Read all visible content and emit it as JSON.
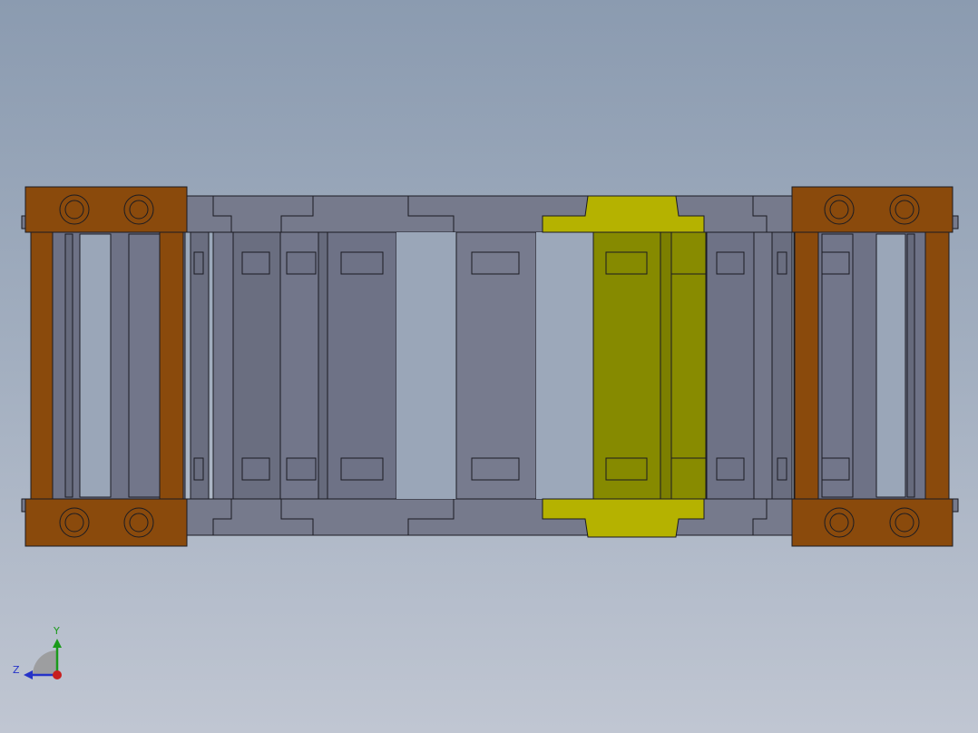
{
  "viewport": {
    "background_top": "#8b9bb0",
    "background_bottom": "#c0c6d2"
  },
  "model": {
    "link_color": "#6f7385",
    "link_dark": "#5e6274",
    "highlight_color": "#868a00",
    "highlight_light": "#b5b200",
    "bracket_color": "#8a4a0c",
    "edge_color": "#1b1b22"
  },
  "triad": {
    "y_label": "Y",
    "z_label": "Z",
    "y_color": "#1a9a1a",
    "z_color": "#2633c8",
    "x_color": "#c81e1e"
  }
}
